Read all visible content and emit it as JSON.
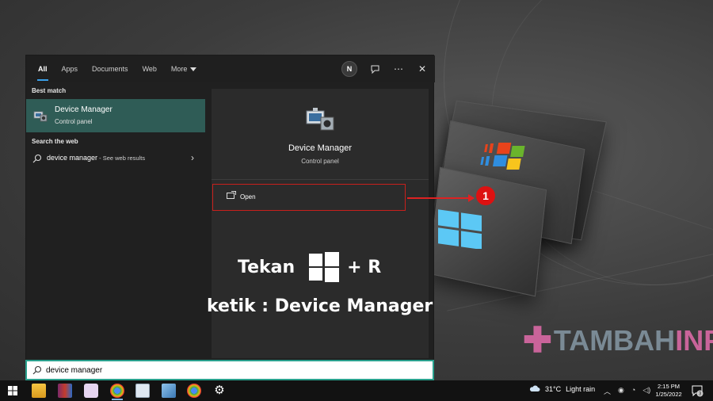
{
  "tabs": {
    "all": "All",
    "apps": "Apps",
    "documents": "Documents",
    "web": "Web",
    "more": "More",
    "avatar_initial": "N"
  },
  "results": {
    "best_match_label": "Best match",
    "best_match_title": "Device Manager",
    "best_match_subtitle": "Control panel",
    "search_web_label": "Search the web",
    "web_query": "device manager",
    "web_suffix": " - See web results"
  },
  "preview": {
    "title": "Device Manager",
    "subtitle": "Control panel",
    "open_label": "Open"
  },
  "overlay": {
    "press_text": "Tekan",
    "plus_key": "+ R",
    "type_text": "ketik : Device Manager",
    "step_number": "1",
    "annotation_color": "#d11111"
  },
  "search_box": {
    "value": "device manager"
  },
  "watermark": {
    "part1": "TAMBAH",
    "part2": "INFO",
    "plus_color": "#c9649a"
  },
  "taskbar": {
    "temperature": "31°C",
    "weather": "Light rain",
    "time": "2:15 PM",
    "date": "1/25/2022",
    "notification_count": "3"
  },
  "colors": {
    "accent_teal": "#2f5c56",
    "search_border": "#2aa08d",
    "tab_underline": "#3aa0e8"
  }
}
